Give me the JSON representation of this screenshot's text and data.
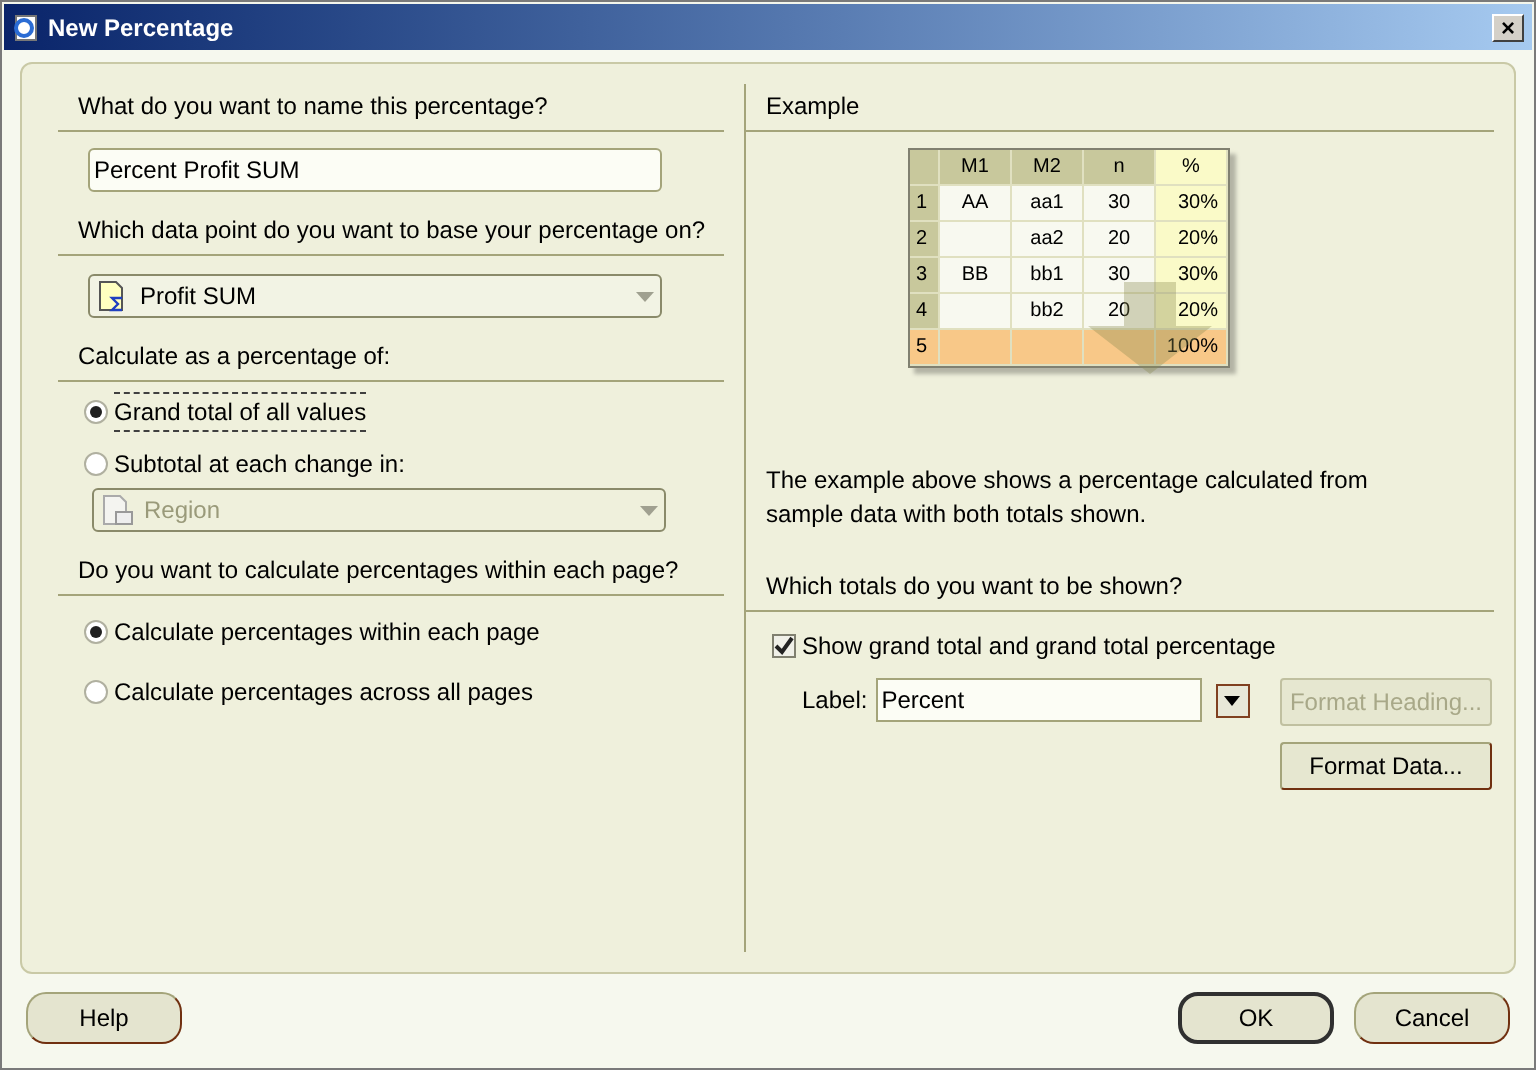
{
  "window": {
    "title": "New Percentage",
    "close": "×"
  },
  "name_section": {
    "heading": "What do you want to name this percentage?",
    "value": "Percent Profit SUM"
  },
  "data_point": {
    "heading": "Which data point do you want to base your percentage on?",
    "value": "Profit SUM",
    "disabled": false
  },
  "calculate_as": {
    "heading": "Calculate as a percentage of:",
    "options": [
      {
        "label": "Grand total of all values",
        "selected": true
      },
      {
        "label": "Subtotal at each change in:",
        "selected": false
      }
    ],
    "subtotal_field": {
      "value": "Region",
      "disabled": true
    }
  },
  "page_section": {
    "heading": "Do you want to calculate percentages within each page?",
    "options": [
      {
        "label": "Calculate percentages within each page",
        "selected": true
      },
      {
        "label": "Calculate percentages across all pages",
        "selected": false
      }
    ]
  },
  "example": {
    "heading": "Example",
    "columns": [
      "M1",
      "M2",
      "n",
      "%"
    ],
    "rows": [
      {
        "index": "1",
        "kind": "data",
        "cells": [
          "AA",
          "aa1",
          "30",
          "30%"
        ]
      },
      {
        "index": "2",
        "kind": "data",
        "cells": [
          "",
          "aa2",
          "20",
          "20%"
        ]
      },
      {
        "index": "3",
        "kind": "data",
        "cells": [
          "BB",
          "bb1",
          "30",
          "30%"
        ]
      },
      {
        "index": "4",
        "kind": "data",
        "cells": [
          "",
          "bb2",
          "20",
          "20%"
        ]
      },
      {
        "index": "5",
        "kind": "total",
        "cells": [
          "",
          "",
          "",
          "100%"
        ]
      }
    ],
    "description": "The example above shows a percentage calculated from sample data with both totals shown."
  },
  "totals": {
    "heading": "Which totals do you want to be shown?",
    "checkbox": {
      "label": "Show grand total and grand total percentage",
      "checked": true
    },
    "label_field": {
      "label": "Label:",
      "value": "Percent"
    },
    "buttons": [
      {
        "label": "Format Heading...",
        "disabled": true
      },
      {
        "label": "Format Data...",
        "disabled": false
      }
    ]
  },
  "footer": {
    "left_buttons": [
      {
        "label": "Help",
        "default": false
      }
    ],
    "right_buttons": [
      {
        "label": "OK",
        "default": true
      },
      {
        "label": "Cancel",
        "default": false
      }
    ]
  }
}
